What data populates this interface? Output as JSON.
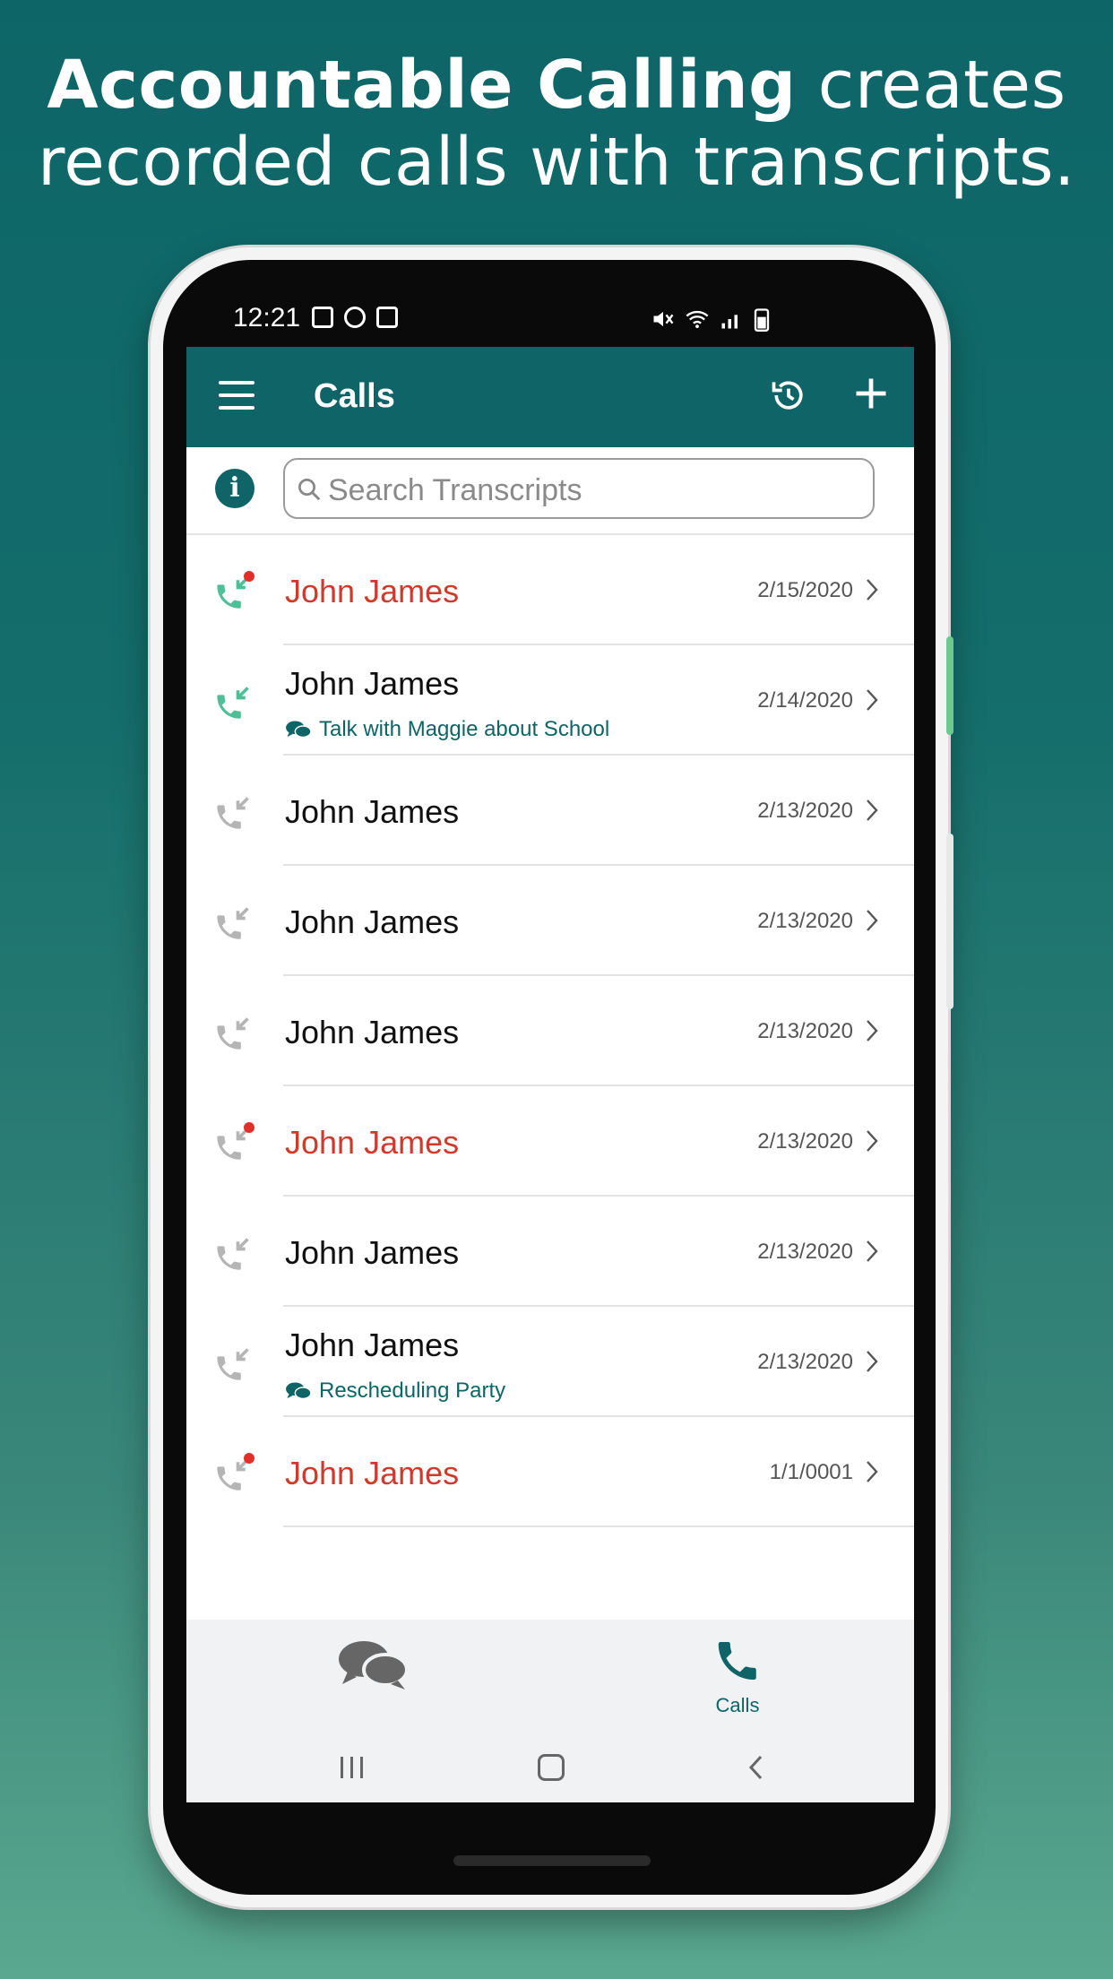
{
  "headline": {
    "bold": "Accountable Calling",
    "rest_line1": " creates",
    "line2": "recorded calls with transcripts."
  },
  "statusbar": {
    "time": "12:21"
  },
  "appbar": {
    "title": "Calls",
    "history_icon": "history-icon",
    "add_icon": "plus-icon"
  },
  "search": {
    "placeholder": "Search Transcripts",
    "value": ""
  },
  "colors": {
    "primary": "#0e6466",
    "missed": "#d03a2c",
    "accent_green": "#4fbf98",
    "icon_gray": "#b5b5b5"
  },
  "calls": [
    {
      "name": "John James",
      "date": "2/15/2020",
      "status": "missed",
      "icon": "incoming-call-icon",
      "note": ""
    },
    {
      "name": "John James",
      "date": "2/14/2020",
      "status": "received",
      "icon": "incoming-call-icon",
      "note": "Talk with Maggie about School"
    },
    {
      "name": "John James",
      "date": "2/13/2020",
      "status": "normal",
      "icon": "call-icon",
      "note": ""
    },
    {
      "name": "John James",
      "date": "2/13/2020",
      "status": "normal",
      "icon": "call-icon",
      "note": ""
    },
    {
      "name": "John James",
      "date": "2/13/2020",
      "status": "normal",
      "icon": "call-icon",
      "note": ""
    },
    {
      "name": "John James",
      "date": "2/13/2020",
      "status": "missed-gray",
      "icon": "call-icon",
      "note": ""
    },
    {
      "name": "John James",
      "date": "2/13/2020",
      "status": "normal",
      "icon": "call-icon",
      "note": ""
    },
    {
      "name": "John James",
      "date": "2/13/2020",
      "status": "normal",
      "icon": "call-icon",
      "note": "Rescheduling Party"
    },
    {
      "name": "John James",
      "date": "1/1/0001",
      "status": "missed-gray",
      "icon": "call-icon",
      "note": ""
    }
  ],
  "bottomnav": {
    "messages_icon": "chat-bubbles-icon",
    "calls_label": "Calls"
  }
}
